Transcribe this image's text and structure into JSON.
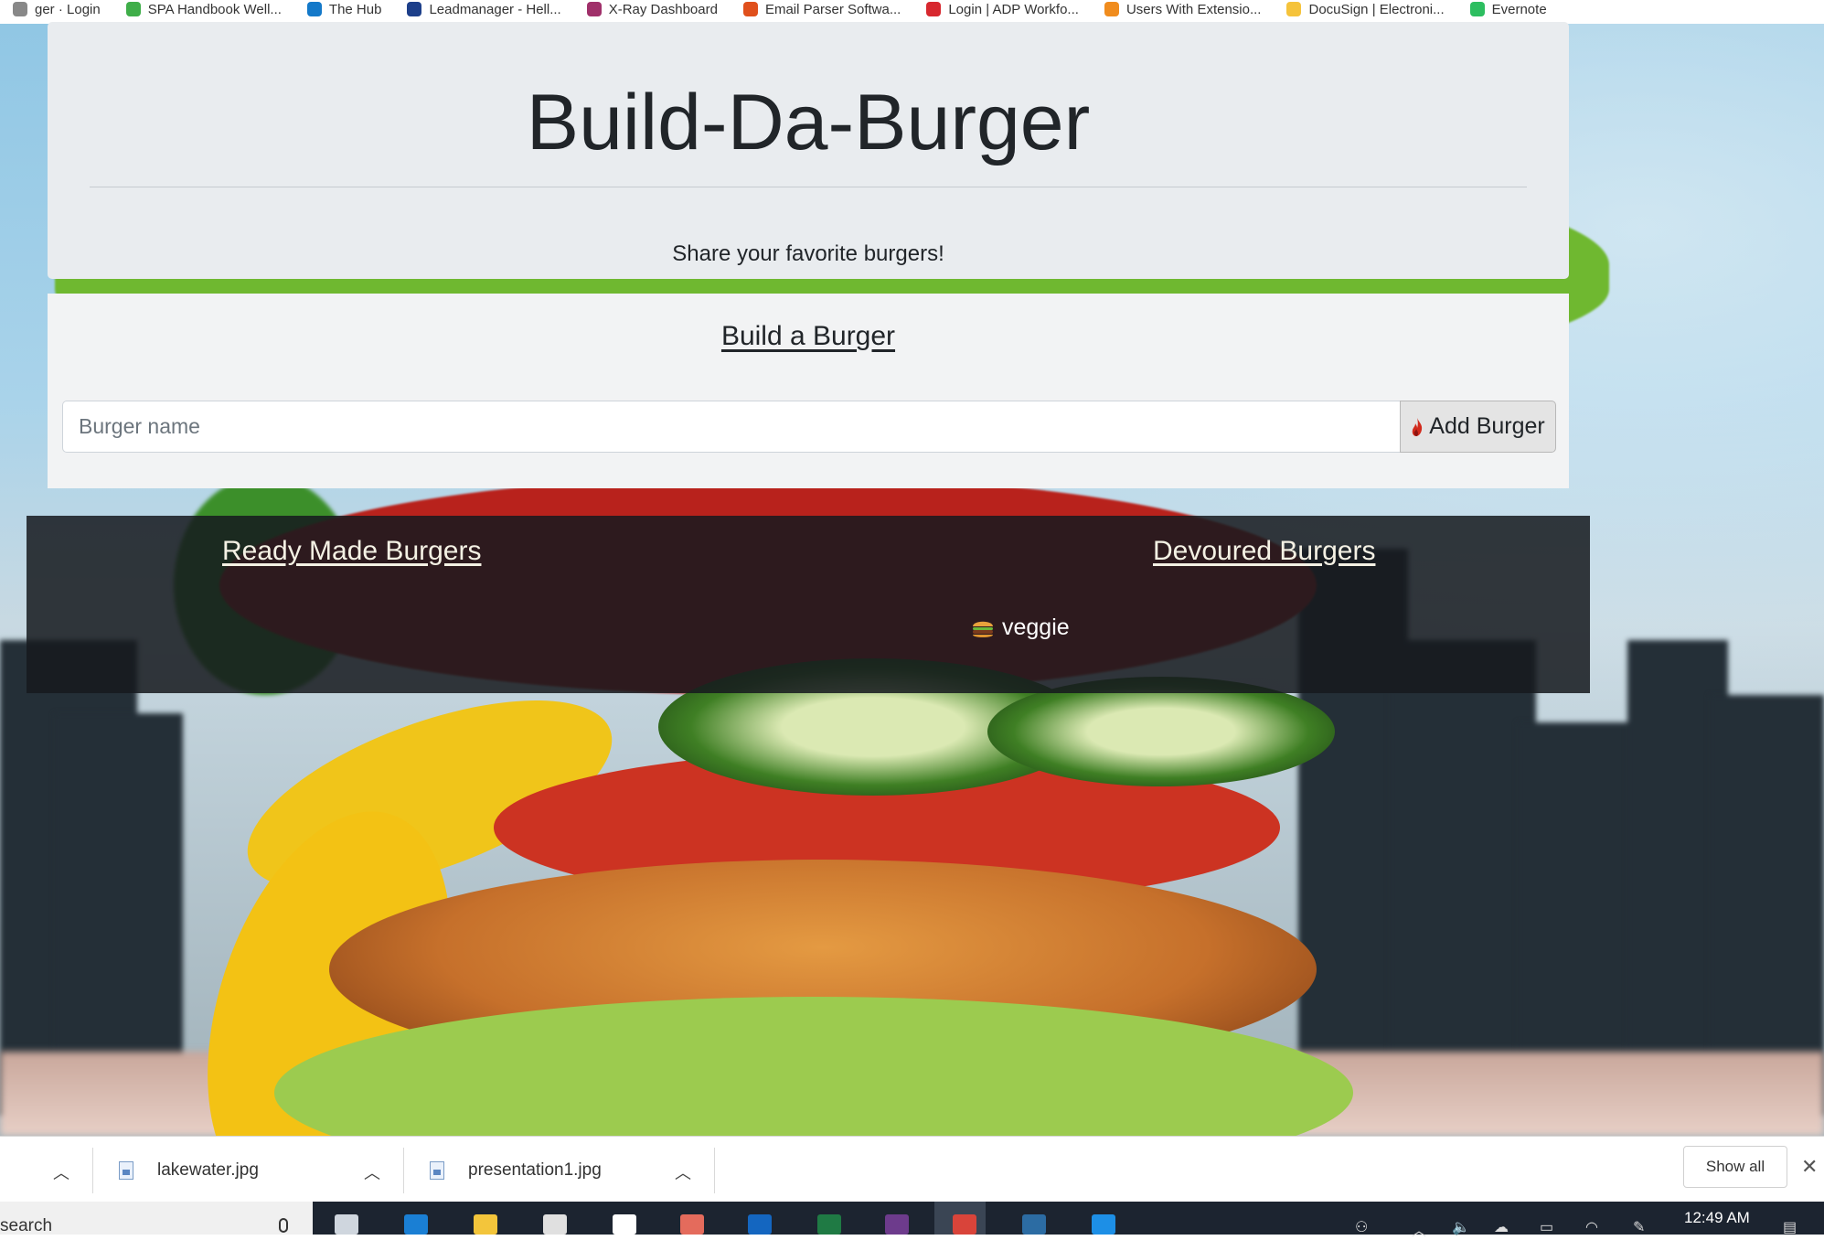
{
  "bookmarks": [
    {
      "label": "ger · Login",
      "icon": "login-icon",
      "color": "#888888"
    },
    {
      "label": "SPA Handbook Well...",
      "icon": "handbook-icon",
      "color": "#3fae49"
    },
    {
      "label": "The Hub",
      "icon": "hub-icon",
      "color": "#1479c9"
    },
    {
      "label": "Leadmanager - Hell...",
      "icon": "pin-icon",
      "color": "#1d3f8a"
    },
    {
      "label": "X-Ray Dashboard",
      "icon": "xray-icon",
      "color": "#a0306a"
    },
    {
      "label": "Email Parser Softwa...",
      "icon": "email-parser-icon",
      "color": "#e0501c"
    },
    {
      "label": "Login | ADP Workfo...",
      "icon": "adp-icon",
      "color": "#d7282f"
    },
    {
      "label": "Users With Extensio...",
      "icon": "users-icon",
      "color": "#f08c1e"
    },
    {
      "label": "DocuSign | Electroni...",
      "icon": "docusign-icon",
      "color": "#f5c33b"
    },
    {
      "label": "Evernote",
      "icon": "evernote-icon",
      "color": "#2dbe60"
    }
  ],
  "header": {
    "title": "Build-Da-Burger",
    "subtitle": "Share your favorite burgers!"
  },
  "builder": {
    "heading": "Build a Burger",
    "input_placeholder": "Burger name",
    "input_value": "",
    "button_label": "Add Burger",
    "button_icon": "flame-icon"
  },
  "burgers": {
    "ready_title": "Ready Made Burgers",
    "devoured_title": "Devoured Burgers",
    "items": [
      {
        "name": "veggie",
        "icon": "burger-icon"
      }
    ]
  },
  "downloads": {
    "files": [
      {
        "name": "lakewater.jpg"
      },
      {
        "name": "presentation1.jpg"
      }
    ],
    "show_all_label": "Show all"
  },
  "taskbar": {
    "search_text": "search",
    "apps": [
      {
        "icon": "task-view-icon",
        "color": "#cfd6de"
      },
      {
        "icon": "edge-icon",
        "color": "#1a7fd4"
      },
      {
        "icon": "file-explorer-icon",
        "color": "#f3c53b"
      },
      {
        "icon": "store-icon",
        "color": "#e0e0e0"
      },
      {
        "icon": "mail-icon",
        "color": "#ffffff"
      },
      {
        "icon": "paint-icon",
        "color": "#e46b5c"
      },
      {
        "icon": "outlook-icon",
        "color": "#1466c0"
      },
      {
        "icon": "excel-icon",
        "color": "#1f7a44"
      },
      {
        "icon": "slack-icon",
        "color": "#6d3b8c"
      },
      {
        "icon": "chrome-icon",
        "color": "#d9443a"
      },
      {
        "icon": "mysql-icon",
        "color": "#2c6ca3"
      },
      {
        "icon": "vscode-icon",
        "color": "#1d8fe6"
      }
    ],
    "time": "12:49 AM"
  }
}
